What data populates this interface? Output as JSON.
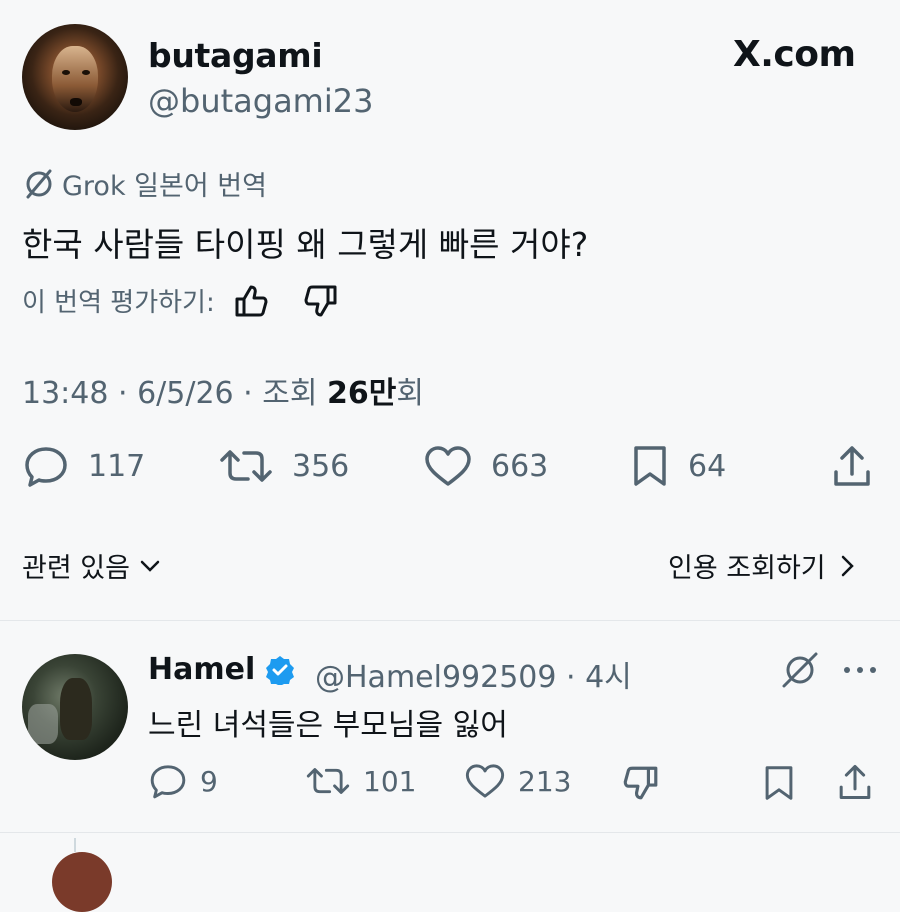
{
  "author": {
    "display_name": "butagami",
    "handle": "@butagami23"
  },
  "brand": "X.com",
  "translation": {
    "label": "Grok 일본어 번역",
    "text": "한국 사람들 타이핑 왜 그렇게 빠른 거야?",
    "rate_label": "이 번역 평가하기:"
  },
  "meta": {
    "time_date": "13:48 · 6/5/26 · 조회 ",
    "views_number": "26만",
    "views_suffix": "회"
  },
  "actions": {
    "replies": "117",
    "reposts": "356",
    "likes": "663",
    "bookmarks": "64"
  },
  "related": {
    "label": "관련 있음",
    "quotes_label": "인용 조회하기"
  },
  "reply": {
    "display_name": "Hamel",
    "handle_time": "@Hamel992509 · 4시",
    "text": "느린 녀석들은 부모님을 잃어",
    "replies": "9",
    "reposts": "101",
    "likes": "213"
  },
  "colors": {
    "verified": "#1d9bf0",
    "muted": "#536471",
    "text": "#0f1419"
  }
}
